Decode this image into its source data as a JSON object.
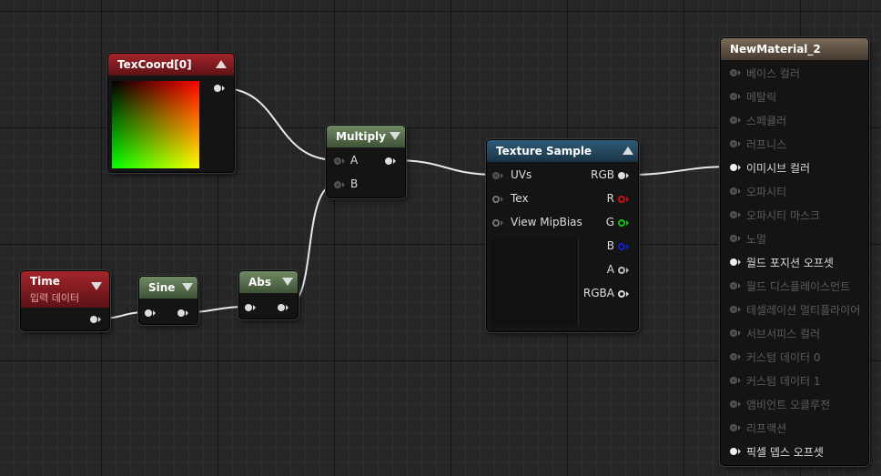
{
  "nodes": {
    "texcoord": {
      "title": "TexCoord[0]"
    },
    "time": {
      "title": "Time",
      "subtitle": "입력 데이터"
    },
    "sine": {
      "title": "Sine"
    },
    "abs": {
      "title": "Abs"
    },
    "multiply": {
      "title": "Multiply",
      "inputs": [
        "A",
        "B"
      ]
    },
    "texture_sample": {
      "title": "Texture Sample",
      "inputs": [
        "UVs",
        "Tex",
        "View MipBias"
      ],
      "outputs": [
        "RGB",
        "R",
        "G",
        "B",
        "A",
        "RGBA"
      ]
    },
    "material": {
      "title": "NewMaterial_2",
      "inputs": [
        {
          "label": "베이스 컬러",
          "active": false
        },
        {
          "label": "메탈릭",
          "active": false
        },
        {
          "label": "스페큘러",
          "active": false
        },
        {
          "label": "러프니스",
          "active": false
        },
        {
          "label": "이미시브 컬러",
          "active": true
        },
        {
          "label": "오파시티",
          "active": false
        },
        {
          "label": "오파시티 마스크",
          "active": false
        },
        {
          "label": "노멀",
          "active": false
        },
        {
          "label": "월드 포지션 오프셋",
          "active": true
        },
        {
          "label": "월드 디스플레이스먼트",
          "active": false
        },
        {
          "label": "테셀레이션 멀티플라이어",
          "active": false
        },
        {
          "label": "서브서피스 컬러",
          "active": false
        },
        {
          "label": "커스텀 데이터 0",
          "active": false
        },
        {
          "label": "커스텀 데이터 1",
          "active": false
        },
        {
          "label": "앰비언트 오클루전",
          "active": false
        },
        {
          "label": "리프랙션",
          "active": false
        },
        {
          "label": "픽셀 뎁스 오프셋",
          "active": true
        }
      ]
    }
  },
  "colors": {
    "grid_bg": "#262626",
    "pin_r": "#d01010",
    "pin_g": "#10c010",
    "pin_b": "#1020d0",
    "wire": "#e8e8e8"
  }
}
